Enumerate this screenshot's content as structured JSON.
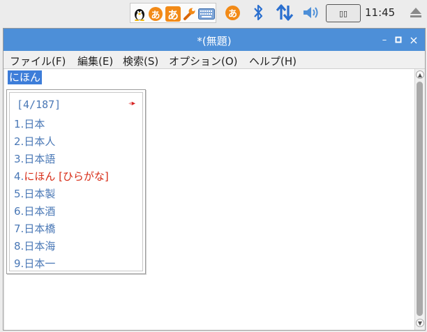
{
  "taskbar": {
    "ime_icons": [
      "tux-icon",
      "hiragana-a-icon",
      "hiragana-a-icon",
      "wrench-icon",
      "keyboard-icon"
    ],
    "ime_glyph": "あ",
    "input_mode_glyph": "あ",
    "keyboard_indicator": "▯▯",
    "clock": "11:45",
    "accent_color": "#f28a17"
  },
  "window": {
    "title": "*(無題)",
    "titlebar_color": "#4d8fd8",
    "minimize": "–",
    "maximize": "▫",
    "close": "×"
  },
  "menubar": {
    "file": "ファイル(F)",
    "edit": "編集(E)",
    "search": "検索(S)",
    "options": "オプション(O)",
    "help": "ヘルプ(H)"
  },
  "editor": {
    "preedit_text": "にほん"
  },
  "candidates": {
    "page": "[4/187]",
    "prev": "◂",
    "next": "▸",
    "items": [
      {
        "num": "1.",
        "text": "日本"
      },
      {
        "num": "2.",
        "text": "日本人"
      },
      {
        "num": "3.",
        "text": "日本語"
      },
      {
        "num": "4.",
        "text": "にほん [ひらがな]"
      },
      {
        "num": "5.",
        "text": "日本製"
      },
      {
        "num": "6.",
        "text": "日本酒"
      },
      {
        "num": "7.",
        "text": "日本橋"
      },
      {
        "num": "8.",
        "text": "日本海"
      },
      {
        "num": "9.",
        "text": "日本一"
      }
    ],
    "selected_index": 3,
    "text_color": "#4a78b6",
    "selected_color": "#d72a14"
  }
}
